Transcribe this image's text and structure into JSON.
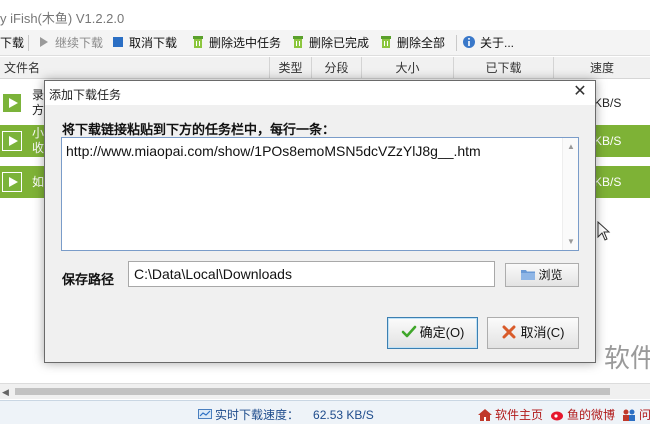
{
  "app": {
    "title": "y iFish(木鱼) V1.2.2.0"
  },
  "toolbar": {
    "items": [
      {
        "label": "下载"
      },
      {
        "label": "继续下载"
      },
      {
        "label": "取消下载"
      },
      {
        "label": "删除选中任务"
      },
      {
        "label": "删除已完成"
      },
      {
        "label": "删除全部"
      },
      {
        "label": "关于..."
      }
    ]
  },
  "columns": [
    "文件名",
    "类型",
    "分段",
    "大小",
    "已下载",
    "速度"
  ],
  "rows": [
    {
      "name": "录方",
      "speed": "KB/S",
      "selected": false
    },
    {
      "name": "小收",
      "speed": "KB/S",
      "selected": true
    },
    {
      "name": "如",
      "speed": "KB/S",
      "selected": true
    }
  ],
  "status": {
    "speed_label": "实时下载速度：",
    "speed_value": "62.53 KB/S",
    "homepage": "软件主页",
    "weibo": "鱼的微博",
    "more": "问"
  },
  "watermark": "软件",
  "dialog": {
    "title": "添加下载任务",
    "instruction": "将下载链接粘贴到下方的任务栏中，每行一条：",
    "url_value": "http://www.miaopai.com/show/1POs8emoMSN5dcVZzYlJ8g__.htm",
    "path_label": "保存路径",
    "path_value": "C:\\Data\\Local\\Downloads",
    "browse_label": "浏览",
    "ok_label": "确定(O)",
    "cancel_label": "取消(C)"
  },
  "colors": {
    "accent_green": "#7eb236",
    "status_blue": "#1e4c8c"
  }
}
